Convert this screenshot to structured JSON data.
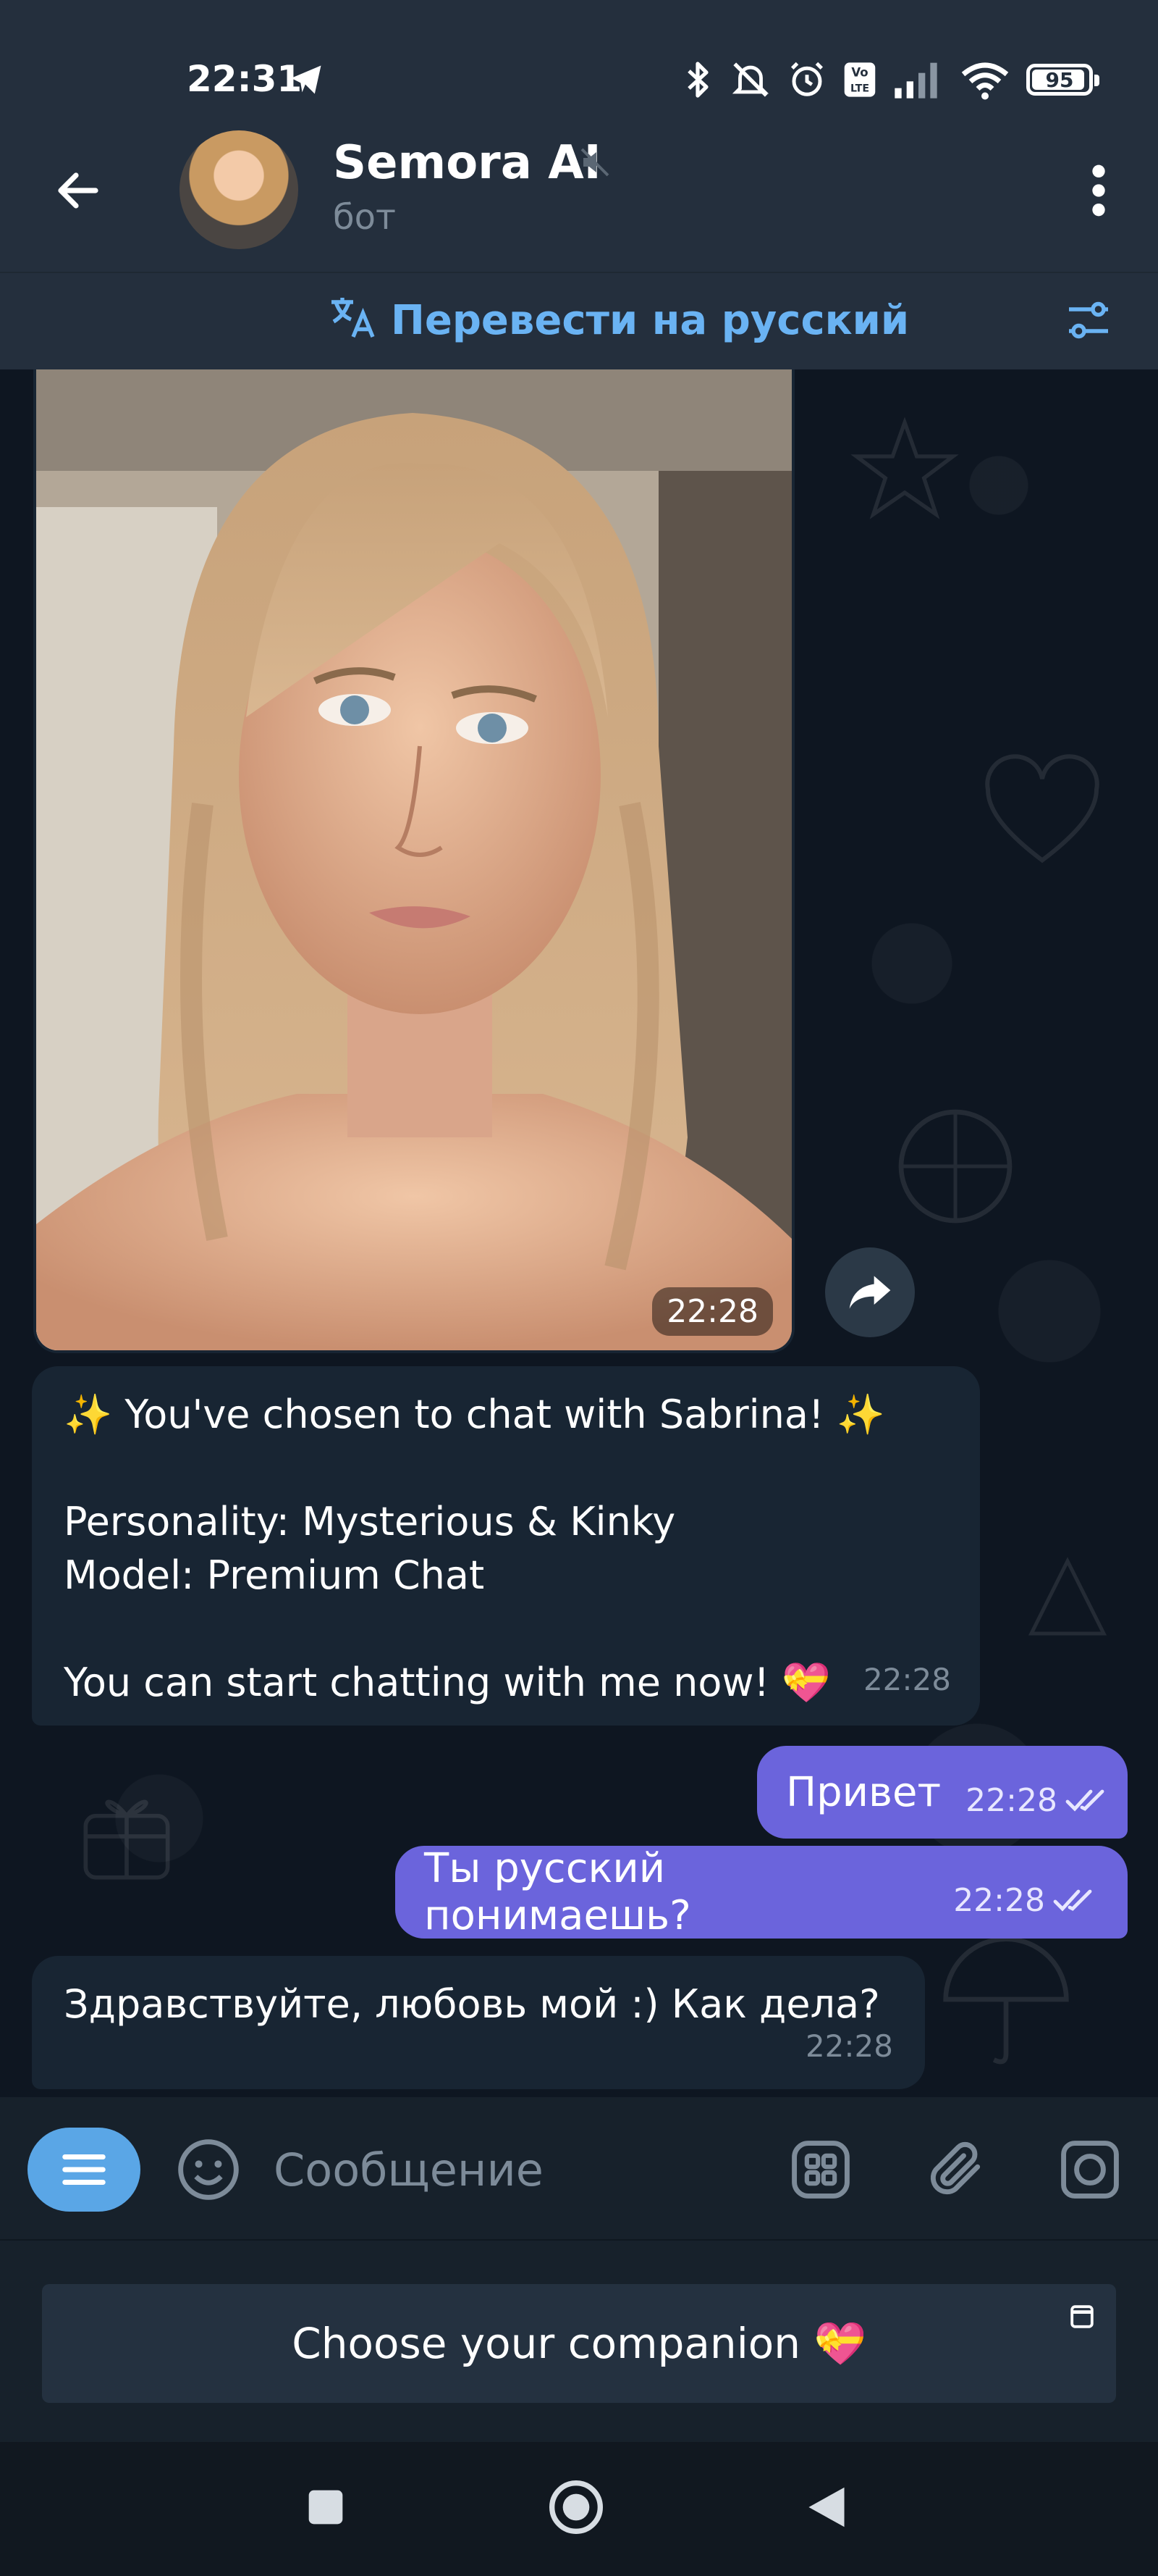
{
  "status_bar": {
    "time": "22:31",
    "battery": "95",
    "battery_fraction": 0.95
  },
  "header": {
    "title": "Semora AI",
    "subtitle": "бот",
    "translate_label": "Перевести на русский"
  },
  "messages": {
    "photo_time": "22:28",
    "intro": {
      "line1": "✨ You've chosen to chat with Sabrina! ✨",
      "line2": "Personality: Mysterious & Kinky",
      "line3": "Model: Premium Chat",
      "line4": "You can start chatting with me now! 💝",
      "time": "22:28"
    },
    "outgoing1": {
      "text": "Привет",
      "time": "22:28"
    },
    "outgoing2": {
      "text": "Ты русский понимаешь?",
      "time": "22:28"
    },
    "incoming2": {
      "text": "Здравствуйте, любовь мой :) Как дела?",
      "time": "22:28"
    }
  },
  "composer": {
    "placeholder": "Сообщение"
  },
  "keyboard": {
    "button_label": "Choose your companion 💝"
  },
  "icons": {
    "back": "arrow-left-icon",
    "menu": "more-vert-icon",
    "translate": "translate-icon",
    "forward": "share-icon",
    "emoji": "emoji-icon",
    "attach": "paperclip-icon",
    "camera": "camera-icon"
  },
  "colors": {
    "accent": "#6ab3f3",
    "outgoing_bubble": "#6b64dc",
    "incoming_bubble": "#182533",
    "header_bg": "#242f3d"
  }
}
